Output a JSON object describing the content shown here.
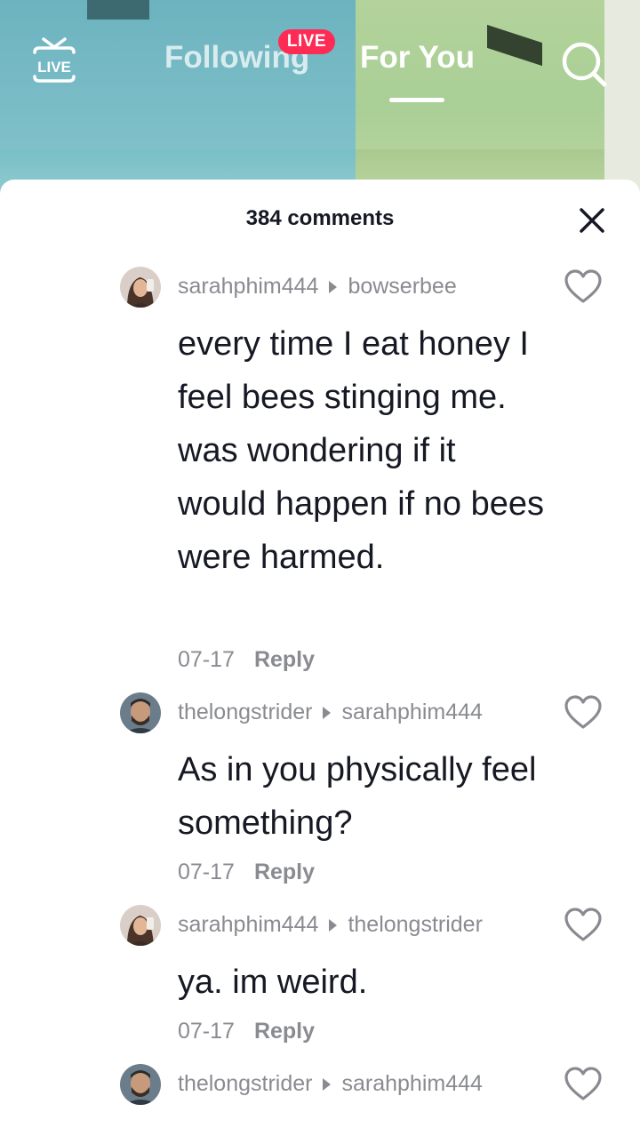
{
  "topnav": {
    "live_icon_text": "LIVE",
    "following_label": "Following",
    "live_badge": "LIVE",
    "foryou_label": "For You",
    "search_icon": "search-icon"
  },
  "comments_panel": {
    "title": "384 comments",
    "close_icon": "close-icon",
    "comments": [
      {
        "author": "sarahphim444",
        "reply_to": "bowserbee",
        "text": "every time I eat honey I feel bees stinging me. was wondering if it would happen if no bees were harmed.",
        "date": "07-17",
        "reply_label": "Reply"
      },
      {
        "author": "thelongstrider",
        "reply_to": "sarahphim444",
        "text": "As in you physically feel something?",
        "date": "07-17",
        "reply_label": "Reply"
      },
      {
        "author": "sarahphim444",
        "reply_to": "thelongstrider",
        "text": "ya. im weird.",
        "date": "07-17",
        "reply_label": "Reply"
      },
      {
        "author": "thelongstrider",
        "reply_to": "sarahphim444",
        "text": "",
        "date": "",
        "reply_label": ""
      }
    ]
  },
  "colors": {
    "accent_live": "#fe2c55",
    "text_primary": "#161823",
    "text_secondary": "#8a8b91"
  }
}
